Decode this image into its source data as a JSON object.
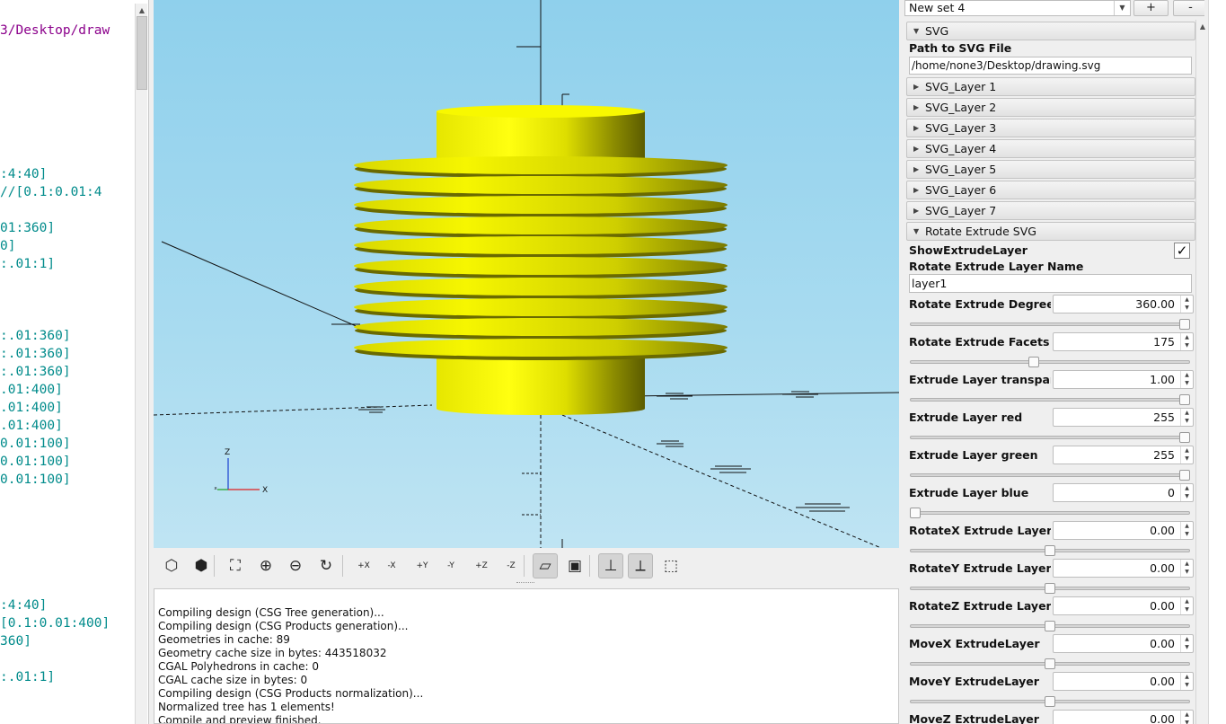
{
  "editor": {
    "lines": [
      {
        "text": "3/Desktop/draw",
        "kind": "str"
      },
      {
        "text": ":4:40]"
      },
      {
        "text": "//[0.1:0.01:4"
      },
      {
        "text": "01:360]"
      },
      {
        "text": "0]"
      },
      {
        "text": ":.01:1]"
      },
      {
        "text": ":.01:360]"
      },
      {
        "text": ":.01:360]"
      },
      {
        "text": ":.01:360]"
      },
      {
        "text": ".01:400]"
      },
      {
        "text": ".01:400]"
      },
      {
        "text": ".01:400]"
      },
      {
        "text": "0.01:100]"
      },
      {
        "text": "0.01:100]"
      },
      {
        "text": "0.01:100]"
      },
      {
        "text": ":4:40]"
      },
      {
        "text": "[0.1:0.01:400]"
      },
      {
        "text": "360]"
      },
      {
        "text": ":.01:1]"
      }
    ]
  },
  "viewport": {
    "axis_labels": {
      "z": "Z",
      "x": "X"
    },
    "object_color": "#f3f300",
    "background_color": "#9fd6ee"
  },
  "toolbar": {
    "buttons": [
      {
        "name": "preview-icon"
      },
      {
        "name": "render-icon"
      },
      {
        "name": "view-all-icon"
      },
      {
        "name": "zoom-in-icon"
      },
      {
        "name": "zoom-out-icon"
      },
      {
        "name": "reset-view-icon"
      },
      {
        "name": "view-right-icon",
        "label": "+X"
      },
      {
        "name": "view-left-icon",
        "label": "-X"
      },
      {
        "name": "view-back-icon",
        "label": "+Y"
      },
      {
        "name": "view-front-icon",
        "label": "-Y"
      },
      {
        "name": "view-top-icon",
        "label": "+Z"
      },
      {
        "name": "view-bottom-icon",
        "label": "-Z"
      },
      {
        "name": "perspective-icon"
      },
      {
        "name": "orthogonal-icon"
      },
      {
        "name": "show-axes-icon"
      },
      {
        "name": "show-scale-icon"
      },
      {
        "name": "show-edges-icon"
      }
    ]
  },
  "console": {
    "lines": [
      "Compiling design (CSG Tree generation)...",
      "Compiling design (CSG Products generation)...",
      "Geometries in cache: 89",
      "Geometry cache size in bytes: 443518032",
      "CGAL Polyhedrons in cache: 0",
      "CGAL cache size in bytes: 0",
      "Compiling design (CSG Products normalization)...",
      "Normalized tree has 1 elements!",
      "Compile and preview finished."
    ]
  },
  "customizer": {
    "preset": {
      "value": "New set 4",
      "add_label": "+",
      "remove_label": "-"
    },
    "svg_group": {
      "title": "SVG",
      "path_label": "Path to SVG File",
      "path_value": "/home/none3/Desktop/drawing.svg"
    },
    "layers": [
      "SVG_Layer 1",
      "SVG_Layer 2",
      "SVG_Layer 3",
      "SVG_Layer 4",
      "SVG_Layer 5",
      "SVG_Layer 6",
      "SVG_Layer 7"
    ],
    "rotate_group": {
      "title": "Rotate Extrude SVG",
      "show_label": "ShowExtrudeLayer",
      "show_checked": true,
      "check_glyph": "✓",
      "layer_name_label": "Rotate Extrude Layer Name",
      "layer_name_value": "layer1"
    },
    "params": [
      {
        "label": "Rotate Extrude Degree",
        "value": "360.00",
        "level": 1.0
      },
      {
        "label": "Rotate Extrude Facets",
        "value": "175",
        "level": 0.44
      },
      {
        "label": "Extrude Layer transpar",
        "value": "1.00",
        "level": 1.0
      },
      {
        "label": "Extrude Layer red",
        "value": "255",
        "level": 1.0
      },
      {
        "label": "Extrude Layer green",
        "value": "255",
        "level": 1.0
      },
      {
        "label": "Extrude Layer blue",
        "value": "0",
        "level": 0.0
      },
      {
        "label": "RotateX Extrude Layer",
        "value": "0.00",
        "level": 0.5
      },
      {
        "label": "RotateY Extrude Layer",
        "value": "0.00",
        "level": 0.5
      },
      {
        "label": "RotateZ Extrude Layer",
        "value": "0.00",
        "level": 0.5
      },
      {
        "label": "MoveX ExtrudeLayer",
        "value": "0.00",
        "level": 0.5
      },
      {
        "label": "MoveY ExtrudeLayer",
        "value": "0.00",
        "level": 0.5
      },
      {
        "label": "MoveZ ExtrudeLayer",
        "value": "0.00",
        "level": 0.5
      }
    ]
  }
}
